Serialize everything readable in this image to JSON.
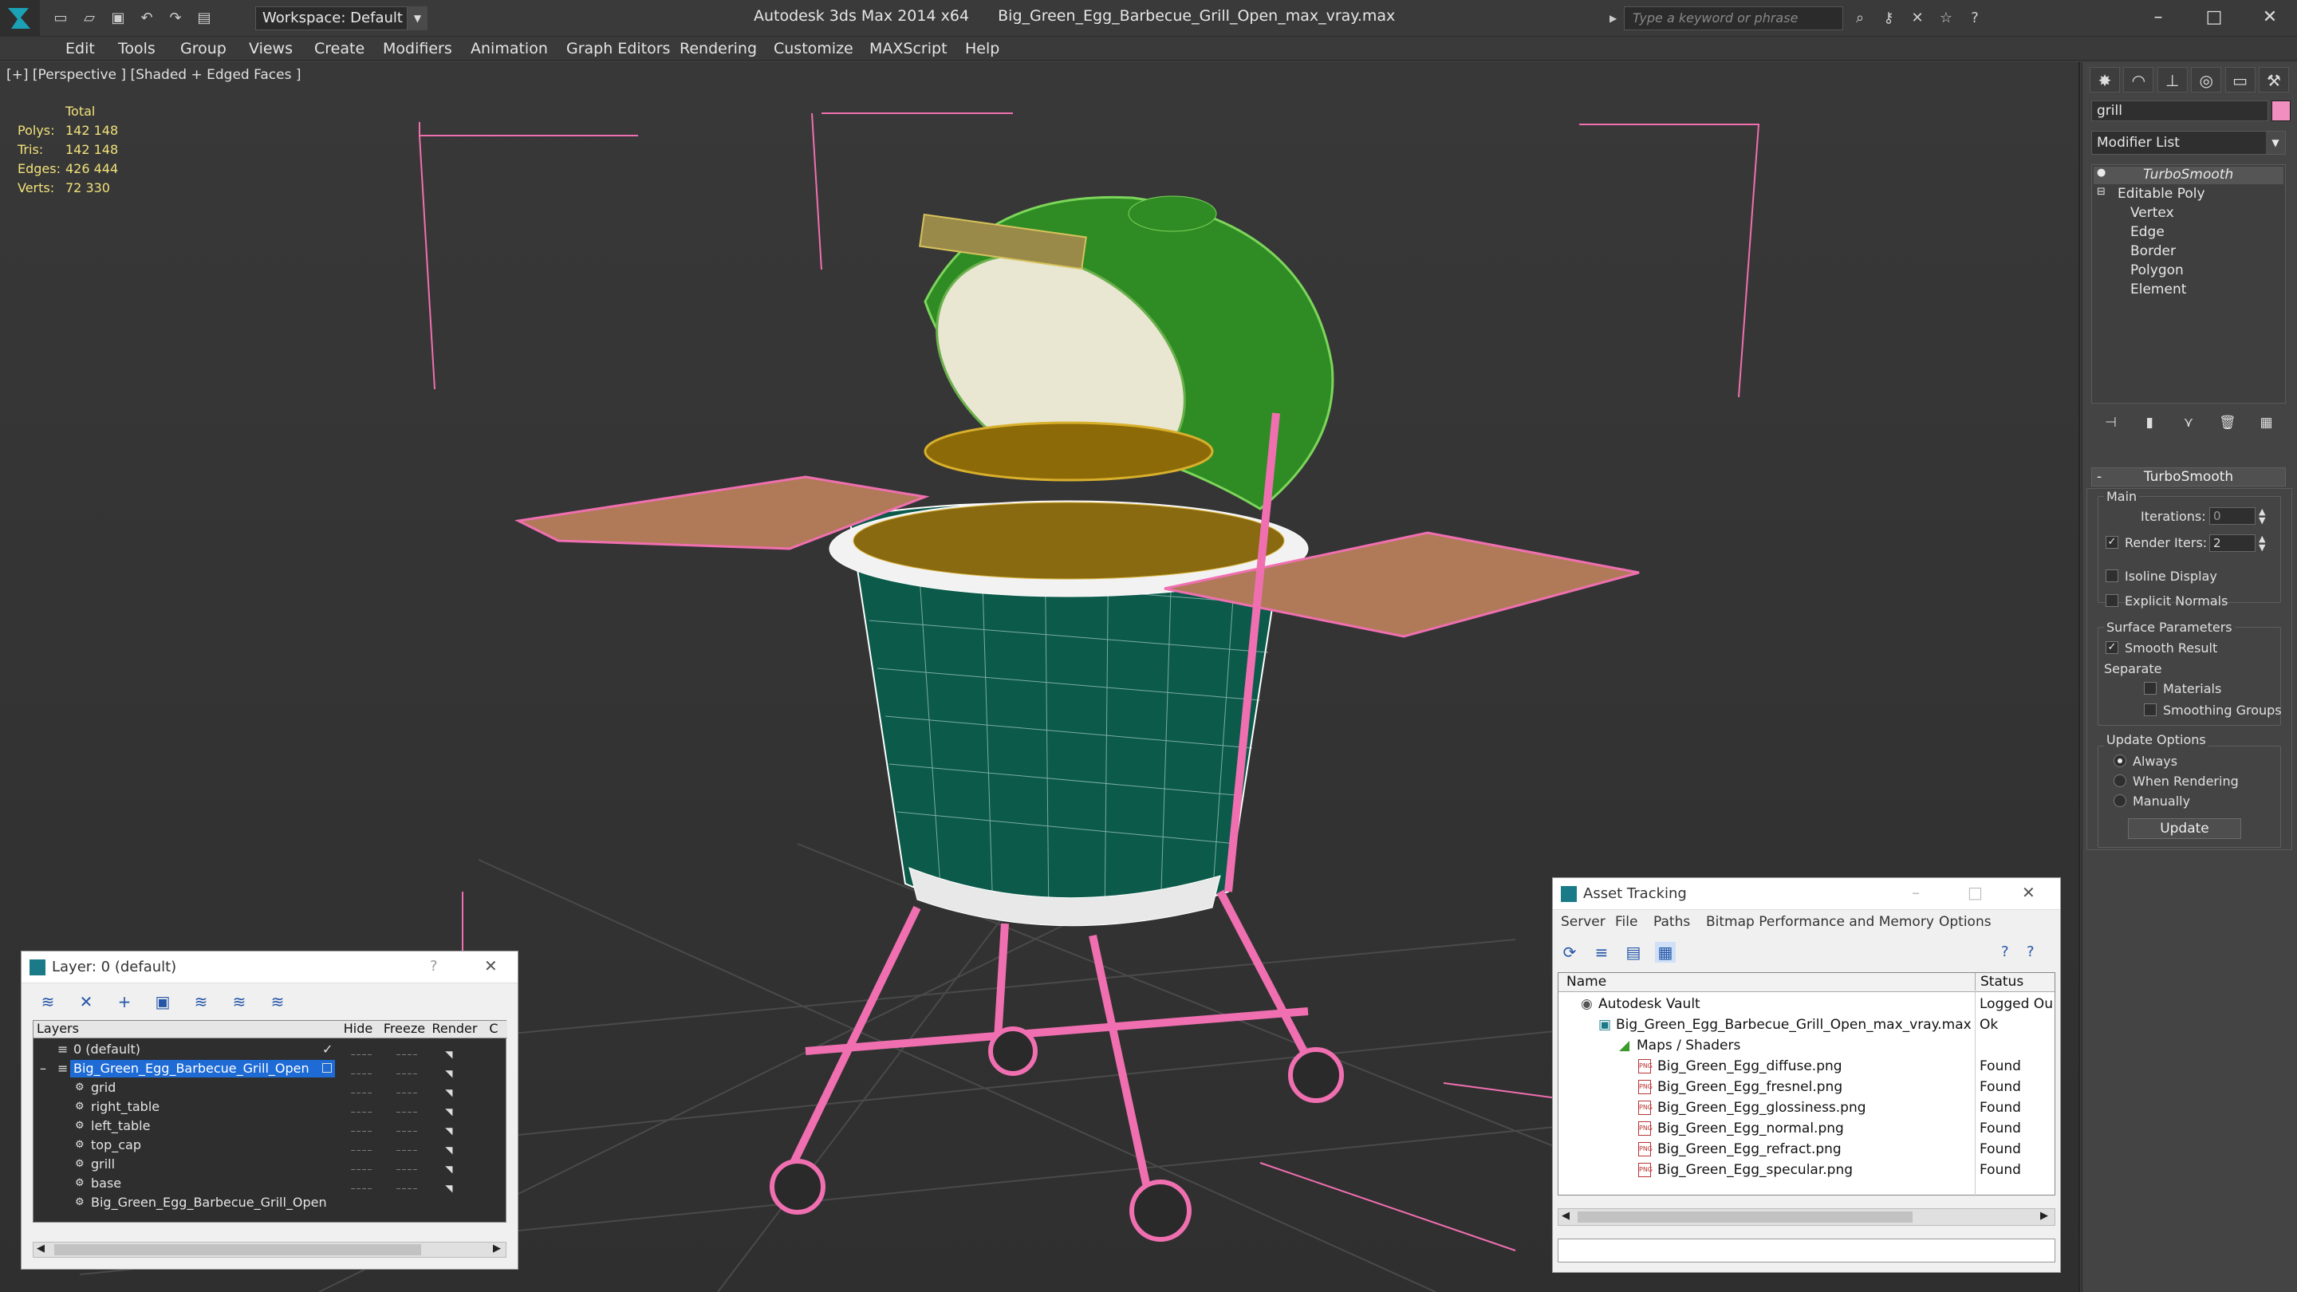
{
  "titlebar": {
    "app": "Autodesk 3ds Max  2014 x64",
    "file": "Big_Green_Egg_Barbecue_Grill_Open_max_vray.max",
    "workspace": "Workspace: Default",
    "search_placeholder": "Type a keyword or phrase"
  },
  "menu": [
    "Edit",
    "Tools",
    "Group",
    "Views",
    "Create",
    "Modifiers",
    "Animation",
    "Graph Editors",
    "Rendering",
    "Customize",
    "MAXScript",
    "Help"
  ],
  "viewport": {
    "label": "[+] [Perspective ] [Shaded + Edged Faces ]",
    "stats": {
      "header": "Total",
      "rows": [
        {
          "k": "Polys:",
          "v": "142 148"
        },
        {
          "k": "Tris:",
          "v": "142 148"
        },
        {
          "k": "Edges:",
          "v": "426 444"
        },
        {
          "k": "Verts:",
          "v": "72 330"
        }
      ]
    }
  },
  "command_panel": {
    "object_name": "grill",
    "modifier_list": "Modifier List",
    "stack": [
      "TurboSmooth",
      "Editable Poly",
      "Vertex",
      "Edge",
      "Border",
      "Polygon",
      "Element"
    ],
    "rollout_title": "TurboSmooth",
    "main_label": "Main",
    "iterations_label": "Iterations:",
    "iterations_value": "0",
    "render_iters_label": "Render Iters:",
    "render_iters_value": "2",
    "isoline": "Isoline Display",
    "explicit": "Explicit Normals",
    "surface_params": "Surface Parameters",
    "smooth_result": "Smooth Result",
    "separate": "Separate",
    "materials": "Materials",
    "smoothing_groups": "Smoothing Groups",
    "update_options": "Update Options",
    "always": "Always",
    "when_rendering": "When Rendering",
    "manually": "Manually",
    "update_btn": "Update"
  },
  "layer_dialog": {
    "title": "Layer: 0 (default)",
    "help": "?",
    "columns": [
      "Layers",
      "Hide",
      "Freeze",
      "Render",
      "C"
    ],
    "layers": [
      {
        "name": "0 (default)"
      },
      {
        "name": "Big_Green_Egg_Barbecue_Grill_Open"
      },
      {
        "name": "grid"
      },
      {
        "name": "right_table"
      },
      {
        "name": "left_table"
      },
      {
        "name": "top_cap"
      },
      {
        "name": "grill"
      },
      {
        "name": "base"
      },
      {
        "name": "Big_Green_Egg_Barbecue_Grill_Open"
      }
    ]
  },
  "asset_tracking": {
    "title": "Asset Tracking",
    "menu": [
      "Server",
      "File",
      "Paths",
      "Bitmap Performance and Memory",
      "Options"
    ],
    "col_name": "Name",
    "col_status": "Status",
    "rows": [
      {
        "name": "Autodesk Vault",
        "status": "Logged Ou"
      },
      {
        "name": "Big_Green_Egg_Barbecue_Grill_Open_max_vray.max",
        "status": "Ok"
      },
      {
        "name": "Maps / Shaders",
        "status": ""
      },
      {
        "name": "Big_Green_Egg_diffuse.png",
        "status": "Found"
      },
      {
        "name": "Big_Green_Egg_fresnel.png",
        "status": "Found"
      },
      {
        "name": "Big_Green_Egg_glossiness.png",
        "status": "Found"
      },
      {
        "name": "Big_Green_Egg_normal.png",
        "status": "Found"
      },
      {
        "name": "Big_Green_Egg_refract.png",
        "status": "Found"
      },
      {
        "name": "Big_Green_Egg_specular.png",
        "status": "Found"
      }
    ]
  },
  "colors": {
    "selection_pink": "#f06fb0",
    "egg_green": "#0b5a4a",
    "lid_green": "#3aa02a",
    "wood": "#b07a58",
    "stats_yellow": "#f2e27a"
  }
}
